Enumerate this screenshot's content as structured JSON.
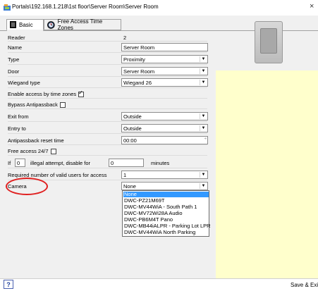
{
  "window": {
    "title": "Portals\\192.168.1.218\\1st floor\\Server Room\\Server Room",
    "close_glyph": "×"
  },
  "tabs": [
    {
      "label": "Basic",
      "active": true
    },
    {
      "label": "Free Access Time Zones",
      "active": false
    }
  ],
  "form": {
    "reader": {
      "label": "Reader",
      "value": "2"
    },
    "name": {
      "label": "Name",
      "value": "Server Room"
    },
    "type": {
      "label": "Type",
      "value": "Proximity"
    },
    "door": {
      "label": "Door",
      "value": "Server Room"
    },
    "wiegand": {
      "label": "Wiegand type",
      "value": "Wiegand 26"
    },
    "enable_tz": {
      "label": "Enable access by time zones",
      "checked": true
    },
    "bypass_apb": {
      "label": "Bypass Antipassback",
      "checked": false
    },
    "exit_from": {
      "label": "Exit from",
      "value": "Outside"
    },
    "entry_to": {
      "label": "Entry to",
      "value": "Outside"
    },
    "apb_reset": {
      "label": "Antipassback reset time",
      "value": "00:00"
    },
    "free_access": {
      "label": "Free access 24/7",
      "checked": false
    },
    "illegal": {
      "prefix": "If",
      "attempts": "0",
      "middle": "illegal attempt, disable for",
      "minutes_value": "0",
      "suffix": "minutes"
    },
    "required_users": {
      "label": "Required number of valid users for access",
      "value": "1"
    },
    "camera": {
      "label": "Camera",
      "value": "None",
      "options": [
        "None",
        "DWC-PZ21M69T",
        "DWC-MV44WiA - South Path 1",
        "DWC-MV72Wi28A Audio",
        "DWC-PB6M4T Pano",
        "DWC-MB44iALPR - Parking Lot LPR",
        "DWC-MV44WiA North Parking"
      ],
      "selected_index": 0
    }
  },
  "bottom": {
    "help_label": "?",
    "save_label": "Save & Exit"
  },
  "colors": {
    "highlight": "#3399ff",
    "annotation": "#e02020",
    "preview_bg": "#ffffcc"
  },
  "icons": {
    "app": "app-icon",
    "basic_tab": "reader-icon",
    "free_tab": "clock-icon"
  }
}
